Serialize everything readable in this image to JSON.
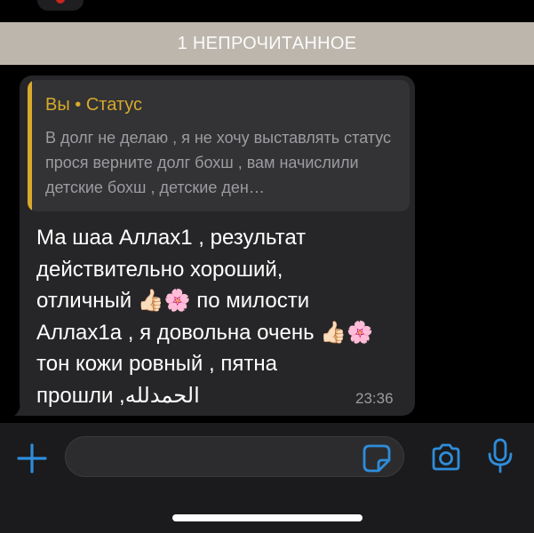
{
  "unread_banner": {
    "label": "1 НЕПРОЧИТАННОЕ"
  },
  "message": {
    "reply_quote": {
      "title": "Вы • Статус",
      "text": "В долг не делаю , я не хочу выставлять статус прося верните долг бохш , вам начислили детские бохш , детские ден…"
    },
    "body": "Ма шаа Аллах1 , результат\nдействительно хороший,\nотличный 👍🏻🌸 по милости\nАллах1а , я довольна очень 👍🏻🌸\nтон кожи ровный , пятна\nпрошли ,الحمدلله",
    "time": "23:36"
  },
  "composer": {
    "input_value": "",
    "icons": [
      "plus-icon",
      "sticker-icon",
      "camera-icon",
      "microphone-icon"
    ]
  },
  "colors": {
    "accent_blue": "#2f8ddb",
    "quote_gold": "#d8a92c",
    "bubble_bg": "#262628",
    "banner_bg": "#bdb6ad"
  }
}
